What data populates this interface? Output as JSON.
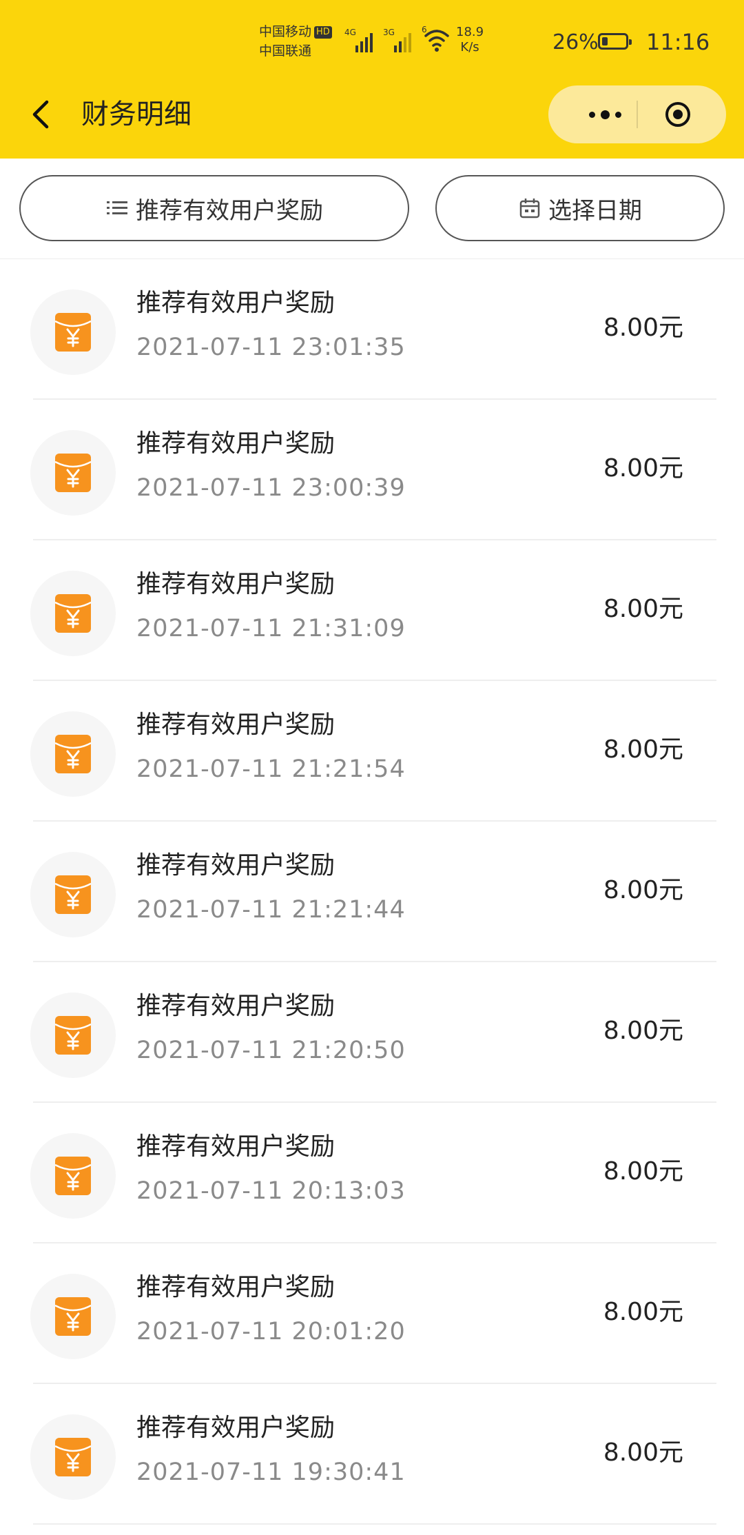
{
  "status_bar": {
    "carrier_1": "中国移动",
    "hd_badge": "HD",
    "carrier_2": "中国联通",
    "signal_1_tag": "4G",
    "signal_2_tag": "3G",
    "wifi_tag": "6",
    "net_speed_value": "18.9",
    "net_speed_unit": "K/s",
    "battery_percent": "26%",
    "battery_level": 0.26,
    "time": "11:16"
  },
  "header": {
    "title": "财务明细",
    "back_icon": "chevron-left-icon",
    "more_icon": "more-dots-icon",
    "close_icon": "target-circle-icon"
  },
  "filters": {
    "type_label": "推荐有效用户奖励",
    "type_icon": "list-icon",
    "date_label": "选择日期",
    "date_icon": "calendar-icon"
  },
  "colors": {
    "header_bg": "#fbd50b",
    "capsule_bg": "#fce99a",
    "red_packet": "#f7931e"
  },
  "transactions": [
    {
      "title": "推荐有效用户奖励",
      "time": "2021-07-11 23:01:35",
      "amount": "8.00元"
    },
    {
      "title": "推荐有效用户奖励",
      "time": "2021-07-11 23:00:39",
      "amount": "8.00元"
    },
    {
      "title": "推荐有效用户奖励",
      "time": "2021-07-11 21:31:09",
      "amount": "8.00元"
    },
    {
      "title": "推荐有效用户奖励",
      "time": "2021-07-11 21:21:54",
      "amount": "8.00元"
    },
    {
      "title": "推荐有效用户奖励",
      "time": "2021-07-11 21:21:44",
      "amount": "8.00元"
    },
    {
      "title": "推荐有效用户奖励",
      "time": "2021-07-11 21:20:50",
      "amount": "8.00元"
    },
    {
      "title": "推荐有效用户奖励",
      "time": "2021-07-11 20:13:03",
      "amount": "8.00元"
    },
    {
      "title": "推荐有效用户奖励",
      "time": "2021-07-11 20:01:20",
      "amount": "8.00元"
    },
    {
      "title": "推荐有效用户奖励",
      "time": "2021-07-11 19:30:41",
      "amount": "8.00元"
    }
  ],
  "transaction_icon": "red-packet-yuan-icon"
}
